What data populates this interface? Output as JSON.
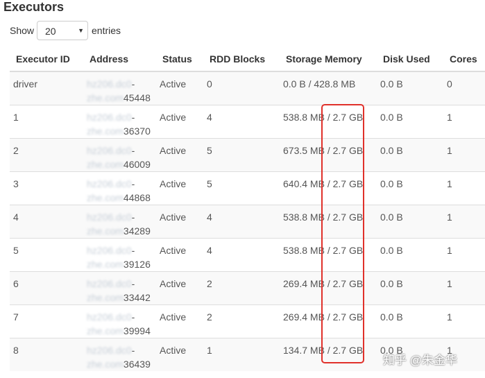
{
  "header": {
    "title": "Executors"
  },
  "length_menu": {
    "show_label": "Show",
    "value": "20",
    "entries_label": "entries"
  },
  "table": {
    "columns": [
      "Executor ID",
      "Address",
      "Status",
      "RDD Blocks",
      "Storage Memory",
      "Disk Used",
      "Cores"
    ],
    "rows": [
      {
        "id": "driver",
        "host1": "hz206.dc0",
        "host2": "zhe.com",
        "port": "45448",
        "status": "Active",
        "rdd": "0",
        "storage": "0.0 B / 428.8 MB",
        "disk": "0.0 B",
        "cores": "0"
      },
      {
        "id": "1",
        "host1": "hz206.dc0",
        "host2": "zhe.com",
        "port": "36370",
        "status": "Active",
        "rdd": "4",
        "storage": "538.8 MB / 2.7 GB",
        "disk": "0.0 B",
        "cores": "1"
      },
      {
        "id": "2",
        "host1": "hz206.dc0",
        "host2": "zhe.com",
        "port": "46009",
        "status": "Active",
        "rdd": "5",
        "storage": "673.5 MB / 2.7 GB",
        "disk": "0.0 B",
        "cores": "1"
      },
      {
        "id": "3",
        "host1": "hz206.dc0",
        "host2": "zhe.com",
        "port": "44868",
        "status": "Active",
        "rdd": "5",
        "storage": "640.4 MB / 2.7 GB",
        "disk": "0.0 B",
        "cores": "1"
      },
      {
        "id": "4",
        "host1": "hz206.dc0",
        "host2": "zhe.com",
        "port": "34289",
        "status": "Active",
        "rdd": "4",
        "storage": "538.8 MB / 2.7 GB",
        "disk": "0.0 B",
        "cores": "1"
      },
      {
        "id": "5",
        "host1": "hz206.dc0",
        "host2": "zhe.com",
        "port": "39126",
        "status": "Active",
        "rdd": "4",
        "storage": "538.8 MB / 2.7 GB",
        "disk": "0.0 B",
        "cores": "1"
      },
      {
        "id": "6",
        "host1": "hz206.dc0",
        "host2": "zhe.com",
        "port": "33442",
        "status": "Active",
        "rdd": "2",
        "storage": "269.4 MB / 2.7 GB",
        "disk": "0.0 B",
        "cores": "1"
      },
      {
        "id": "7",
        "host1": "hz206.dc0",
        "host2": "zhe.com",
        "port": "39994",
        "status": "Active",
        "rdd": "2",
        "storage": "269.4 MB / 2.7 GB",
        "disk": "0.0 B",
        "cores": "1"
      },
      {
        "id": "8",
        "host1": "hz206.dc0",
        "host2": "zhe.com",
        "port": "36439",
        "status": "Active",
        "rdd": "1",
        "storage": "134.7 MB / 2.7 GB",
        "disk": "0.0 B",
        "cores": "1"
      }
    ]
  },
  "annotation": {
    "color": "#e0302a"
  },
  "watermark": {
    "text": "知乎 @朱金华"
  }
}
